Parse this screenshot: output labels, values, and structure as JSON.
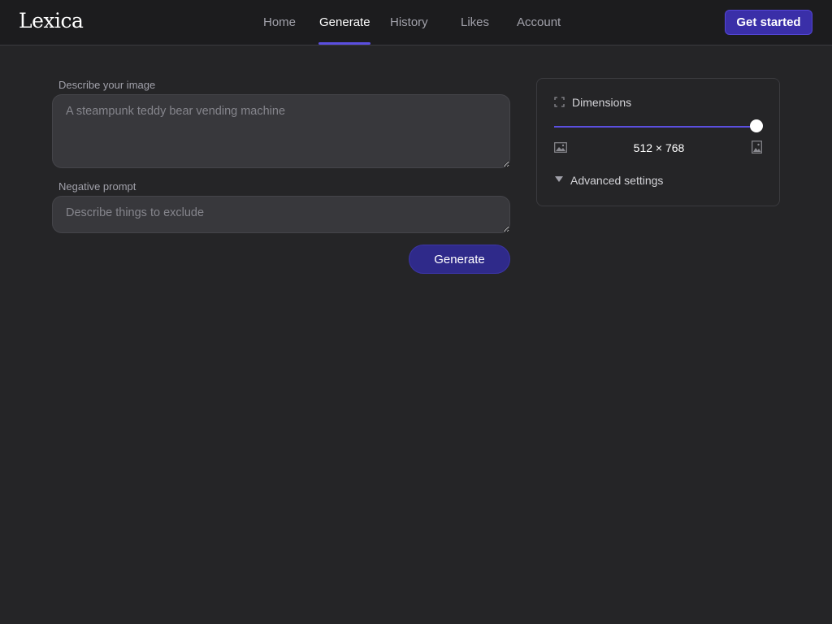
{
  "header": {
    "logo": "Lexica",
    "nav": [
      "Home",
      "Generate",
      "History",
      "Likes",
      "Account"
    ],
    "active_nav": "Generate",
    "cta_label": "Get started"
  },
  "form": {
    "prompt_label": "Describe your image",
    "prompt_placeholder": "A steampunk teddy bear vending machine",
    "negative_label": "Negative prompt",
    "negative_placeholder": "Describe things to exclude",
    "generate_label": "Generate"
  },
  "panel": {
    "dimensions_label": "Dimensions",
    "dimensions_value": "512 × 768",
    "slider_level": 1.0,
    "advanced_label": "Advanced settings"
  },
  "colors": {
    "accent": "#5b4fe0",
    "button": "#2f2a8a",
    "cta": "#3a2fa8",
    "background": "#252527",
    "topbar": "#1c1c1e"
  },
  "icons": [
    "expand-icon",
    "landscape-image-icon",
    "portrait-image-icon",
    "caret-down-icon"
  ]
}
